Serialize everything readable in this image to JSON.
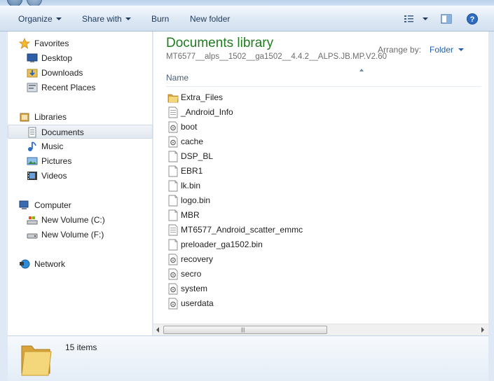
{
  "toolbar": {
    "organize": "Organize",
    "share_with": "Share with",
    "burn": "Burn",
    "new_folder": "New folder"
  },
  "nav": {
    "favorites_header": "Favorites",
    "favorites": [
      "Desktop",
      "Downloads",
      "Recent Places"
    ],
    "libraries_header": "Libraries",
    "libraries": [
      "Documents",
      "Music",
      "Pictures",
      "Videos"
    ],
    "computer_header": "Computer",
    "drives": [
      "New Volume (C:)",
      "New Volume (F:)"
    ],
    "network": "Network",
    "selected": "Documents"
  },
  "library": {
    "title": "Documents library",
    "subtitle": "MT6577__alps__1502__ga1502__4.4.2__ALPS.JB.MP.V2.60",
    "arrange_by_label": "Arrange by:",
    "arrange_by_value": "Folder",
    "column_name": "Name"
  },
  "files": [
    {
      "name": "Extra_Files",
      "icon": "folder-icon"
    },
    {
      "name": "_Android_Info",
      "icon": "text-file-icon"
    },
    {
      "name": "boot",
      "icon": "system-file-icon"
    },
    {
      "name": "cache",
      "icon": "system-file-icon"
    },
    {
      "name": "DSP_BL",
      "icon": "blank-file-icon"
    },
    {
      "name": "EBR1",
      "icon": "blank-file-icon"
    },
    {
      "name": "lk.bin",
      "icon": "blank-file-icon"
    },
    {
      "name": "logo.bin",
      "icon": "blank-file-icon"
    },
    {
      "name": "MBR",
      "icon": "blank-file-icon"
    },
    {
      "name": "MT6577_Android_scatter_emmc",
      "icon": "text-file-icon"
    },
    {
      "name": "preloader_ga1502.bin",
      "icon": "blank-file-icon"
    },
    {
      "name": "recovery",
      "icon": "system-file-icon"
    },
    {
      "name": "secro",
      "icon": "system-file-icon"
    },
    {
      "name": "system",
      "icon": "system-file-icon"
    },
    {
      "name": "userdata",
      "icon": "system-file-icon"
    }
  ],
  "details": {
    "item_count": "15 items"
  },
  "colors": {
    "title_green": "#1e7d1e",
    "link_blue": "#1e5fa8",
    "toolbar_text": "#1e395b"
  }
}
